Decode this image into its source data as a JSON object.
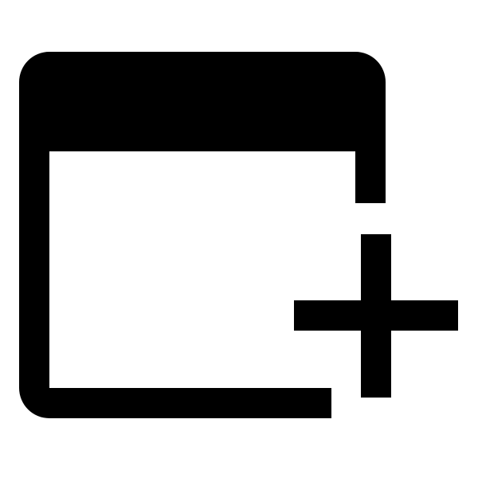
{
  "icon": {
    "name": "new-window-icon",
    "color": "#000000",
    "background": "#ffffff"
  }
}
